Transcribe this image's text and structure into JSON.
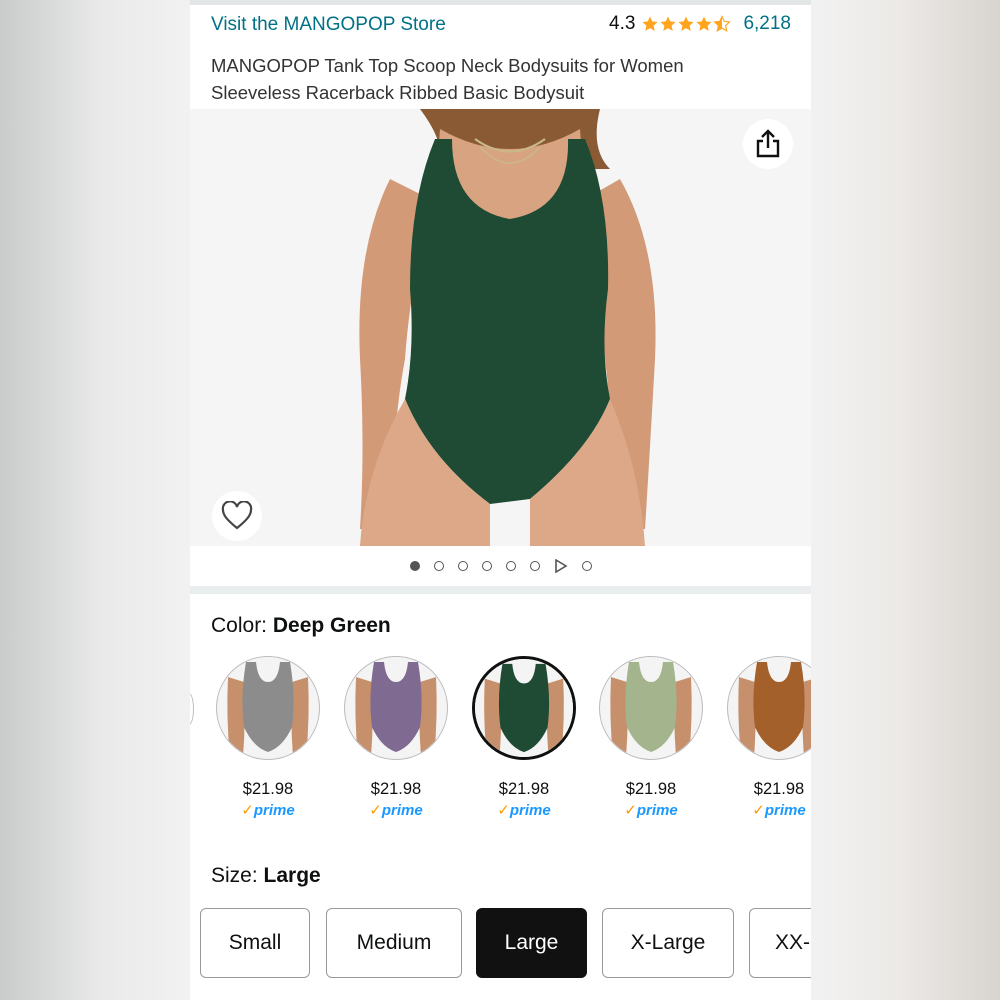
{
  "header": {
    "store_link": "Visit the MANGOPOP Store",
    "rating_value": "4.3",
    "rating_count": "6,218",
    "star_color": "#ffa41c"
  },
  "product": {
    "title": "MANGOPOP Tank Top Scoop Neck Bodysuits for Women Sleeveless Racerback Ribbed Basic Bodysuit"
  },
  "gallery": {
    "share_icon": "share-icon",
    "favorite_icon": "heart-icon",
    "image_count": 8,
    "active_index": 0,
    "video_index": 6
  },
  "color_selector": {
    "label": "Color:",
    "selected": "Deep Green",
    "options": [
      {
        "name": "Grey",
        "color": "#8c8c8c",
        "price": "$21.98",
        "prime": "prime"
      },
      {
        "name": "Purple",
        "color": "#7f6a92",
        "price": "$21.98",
        "prime": "prime"
      },
      {
        "name": "Deep Green",
        "color": "#1f4a34",
        "price": "$21.98",
        "prime": "prime"
      },
      {
        "name": "Sage",
        "color": "#a4b58e",
        "price": "$21.98",
        "prime": "prime"
      },
      {
        "name": "Brown",
        "color": "#a3602a",
        "price": "$21.98",
        "prime": "prime"
      }
    ]
  },
  "size_selector": {
    "label": "Size:",
    "selected": "Large",
    "options": [
      "Small",
      "Medium",
      "Large",
      "X-Large",
      "XX-"
    ]
  }
}
